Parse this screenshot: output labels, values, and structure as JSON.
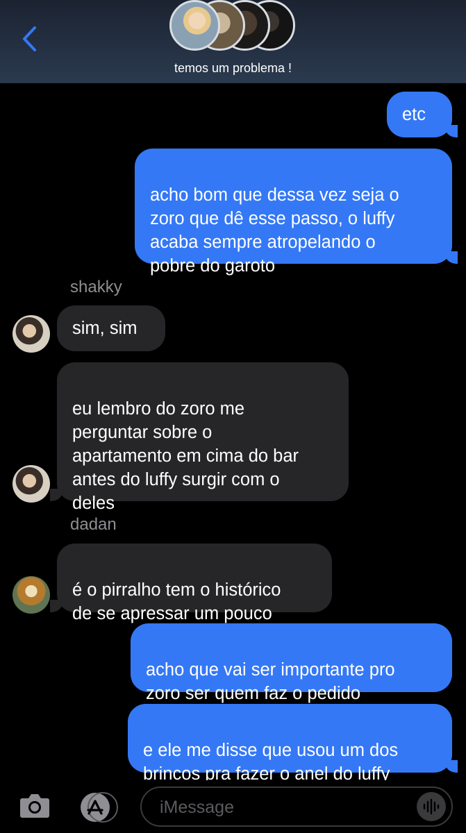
{
  "header": {
    "title": "temos um problema !",
    "back_icon": "chevron-left-icon",
    "accent": "#3478f6"
  },
  "messages": [
    {
      "direction": "sent",
      "text": "etc"
    },
    {
      "direction": "sent",
      "text": "acho bom que dessa vez seja o\nzoro que dê esse passo, o luffy\nacaba sempre atropelando o\npobre do garoto"
    },
    {
      "direction": "received",
      "sender": "shakky",
      "text": "sim, sim"
    },
    {
      "direction": "received",
      "sender": "shakky",
      "text": "eu lembro do zoro me\nperguntar sobre o\napartamento em cima do bar\nantes do luffy surgir com o\ndeles"
    },
    {
      "direction": "received",
      "sender": "dadan",
      "text": "é o pirralho tem o histórico\nde se apressar um pouco"
    },
    {
      "direction": "sent",
      "text": "acho que vai ser importante pro\nzoro ser quem faz o pedido"
    },
    {
      "direction": "sent",
      "text": "e ele me disse que usou um dos\nbrincos pra fazer o anel do luffy"
    }
  ],
  "input": {
    "placeholder": "iMessage"
  },
  "colors": {
    "sent_bubble": "#3478f6",
    "received_bubble": "#262628",
    "sender_name": "#8e8e93"
  }
}
